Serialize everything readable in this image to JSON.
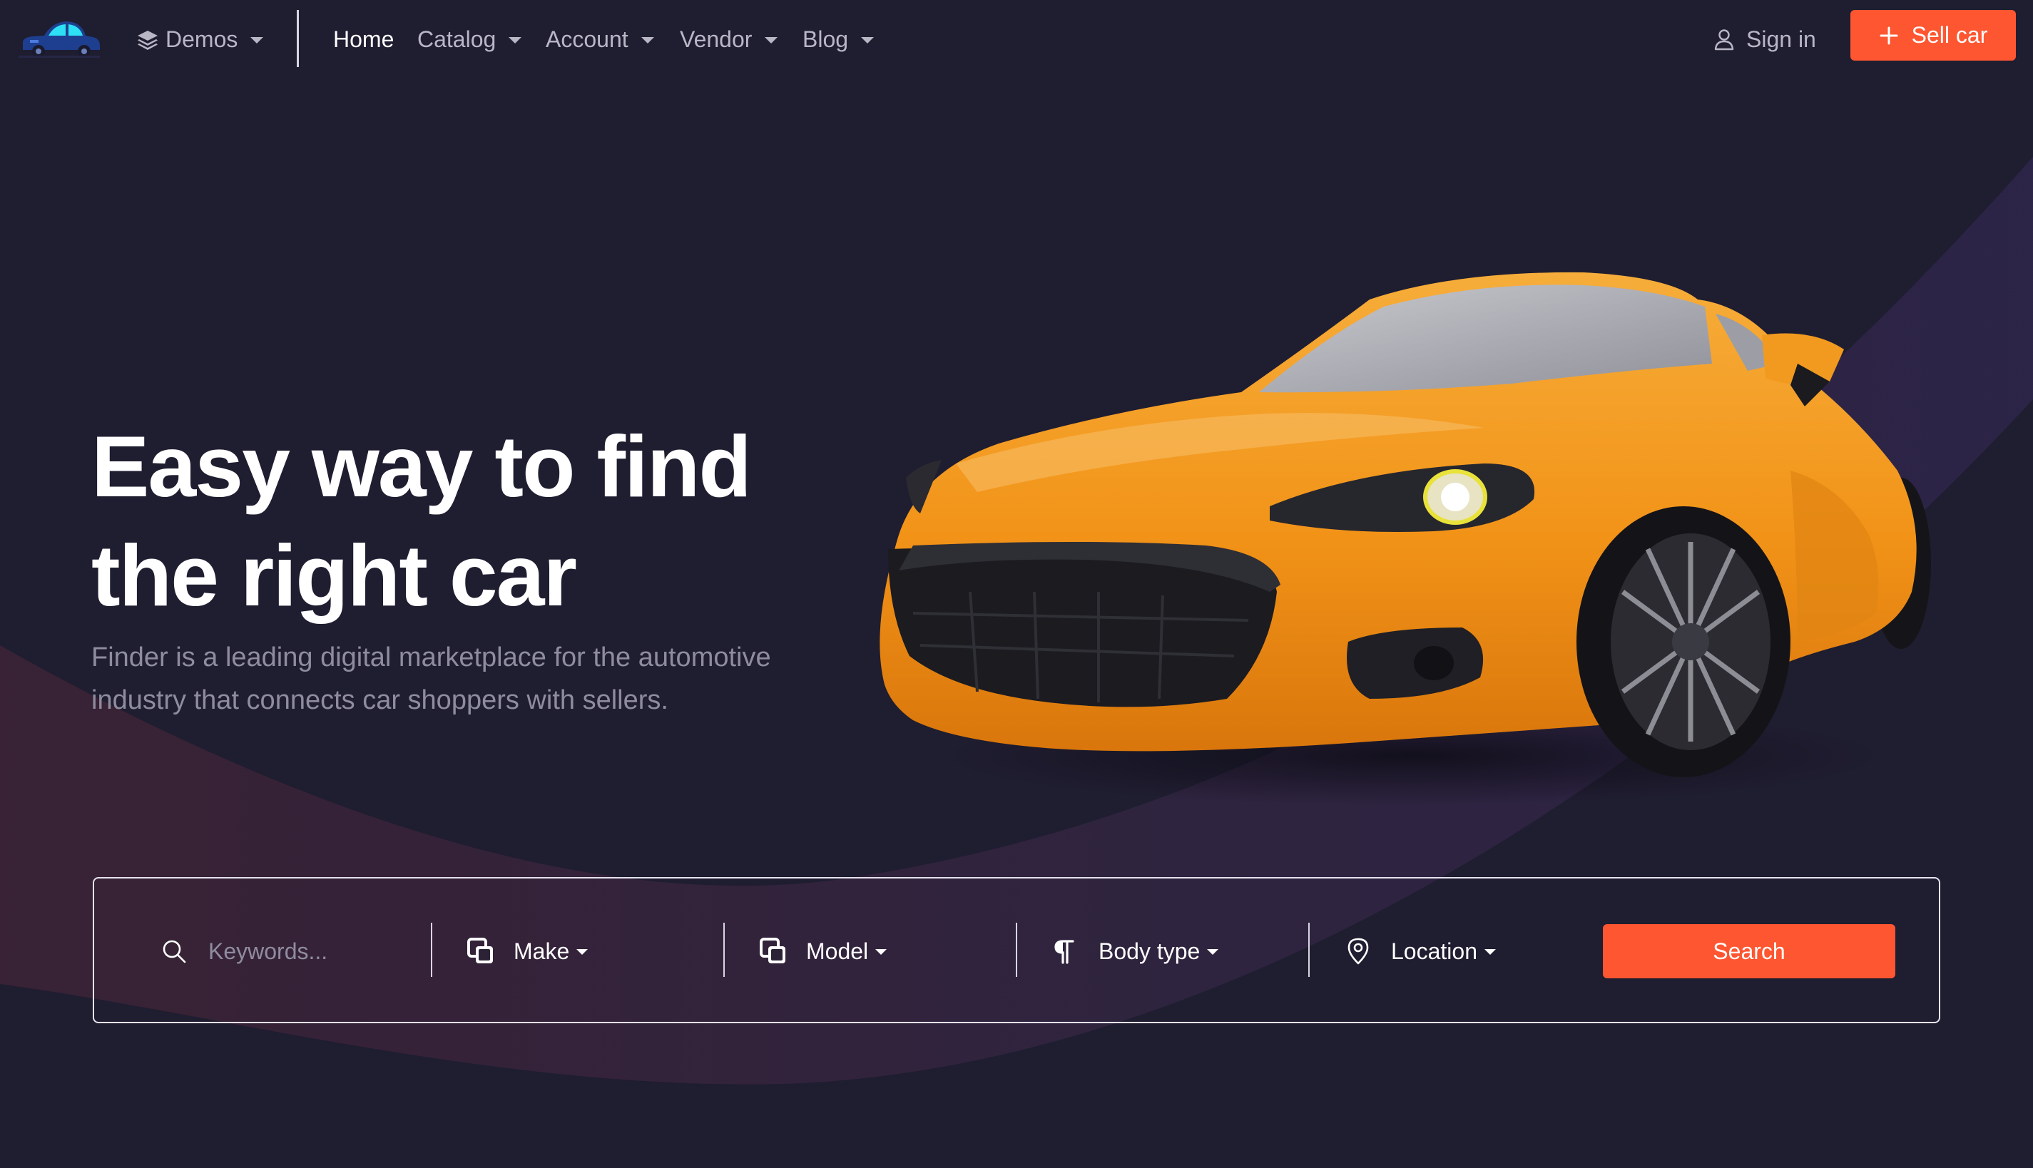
{
  "nav": {
    "demos": "Demos",
    "home": "Home",
    "catalog": "Catalog",
    "account": "Account",
    "vendor": "Vendor",
    "blog": "Blog",
    "sign_in": "Sign in",
    "sell_car": "Sell car"
  },
  "hero": {
    "title_line1": "Easy way to find",
    "title_line2": "the right car",
    "subtitle_line1": "Finder is a leading digital marketplace for the automotive",
    "subtitle_line2": "industry that connects car shoppers with sellers."
  },
  "search": {
    "keywords_placeholder": "Keywords...",
    "make": "Make",
    "model": "Model",
    "body_type": "Body type",
    "location": "Location",
    "button": "Search"
  },
  "colors": {
    "accent": "#fd5631",
    "background": "#1f1d30",
    "car_body": "#f59a1e"
  },
  "icons": {
    "logo": "car-logo-icon",
    "demos": "layers-icon",
    "sign_in": "user-icon",
    "sell": "plus-icon",
    "keywords": "search-icon",
    "make": "squares-icon",
    "model": "squares-icon",
    "body_type": "pilcrow-icon",
    "location": "map-pin-icon"
  }
}
